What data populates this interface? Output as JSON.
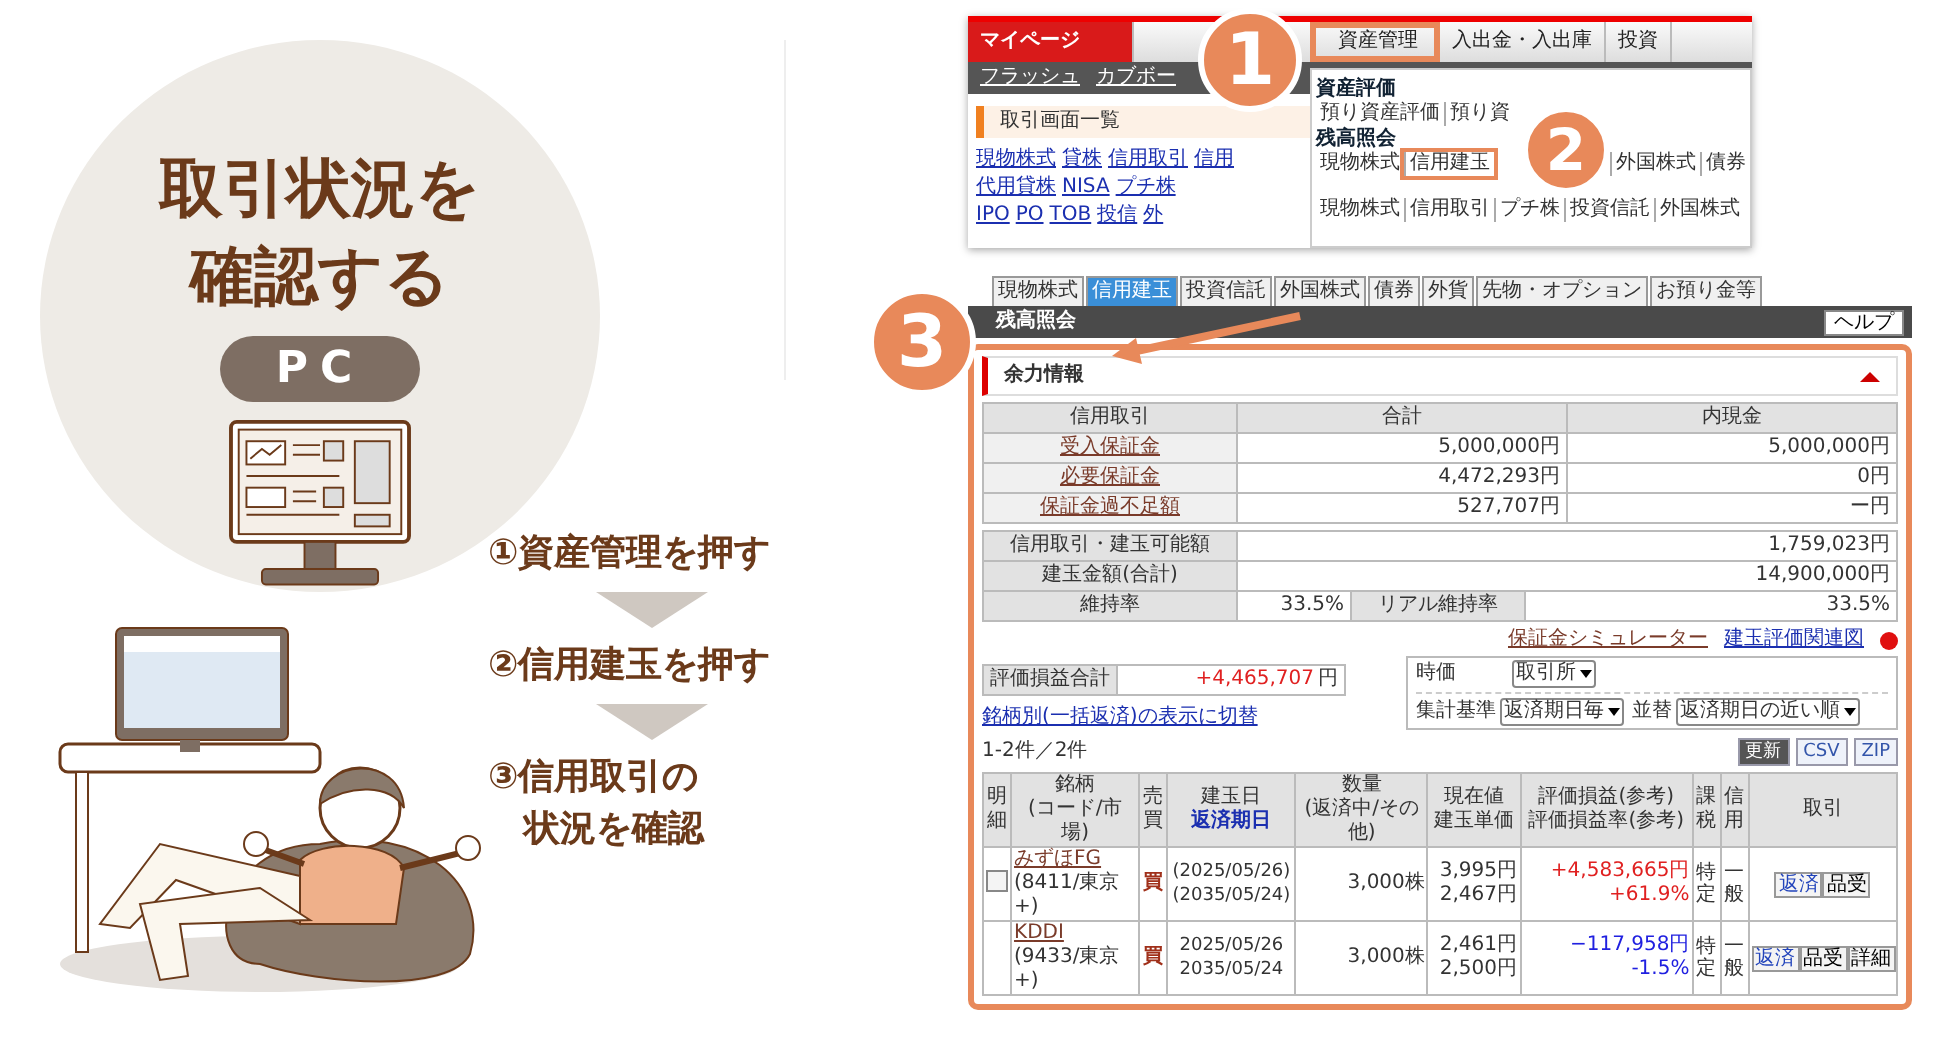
{
  "hero": {
    "title": [
      "取引状況を",
      "確認する"
    ],
    "badge": "PC"
  },
  "steps": [
    {
      "lines": [
        "①資産管理を押す"
      ]
    },
    {
      "lines": [
        "②信用建玉を押す"
      ]
    },
    {
      "lines": [
        "③信用取引の",
        "状況を確認"
      ]
    }
  ],
  "callouts": [
    "1",
    "2",
    "3"
  ],
  "menu_screen": {
    "nav": [
      {
        "label": "マイページ",
        "kind": "mypage",
        "selected": false
      },
      {
        "label": "資産管理",
        "kind": "tab",
        "selected": true
      },
      {
        "label": "入出金・入出庫",
        "kind": "tab",
        "selected": false
      },
      {
        "label": "投資",
        "kind": "tab",
        "selected": false
      }
    ],
    "tools": [
      "フラッシュ",
      "カブボー"
    ],
    "section": "取引画面一覧",
    "link_rows": [
      [
        "現物株式",
        "貸株",
        "信用取引",
        "信用"
      ],
      [
        "代用貸株",
        "NISA",
        "プチ株"
      ],
      [
        "IPO",
        "PO",
        "TOB",
        "投信",
        "外"
      ]
    ],
    "dropdown": [
      {
        "heading": "資産評価",
        "items": [
          {
            "label": "預り資産評価",
            "selected": false
          },
          {
            "label": "預り資",
            "selected": false
          }
        ]
      },
      {
        "heading": "残高照会",
        "items": [
          {
            "label": "現物株式",
            "selected": false
          },
          {
            "label": "信用建玉",
            "selected": true
          },
          {
            "label": "外国株式",
            "selected": false
          },
          {
            "label": "債券",
            "selected": false
          }
        ]
      },
      {
        "items": [
          {
            "label": "現物株式",
            "selected": false
          },
          {
            "label": "信用取引",
            "selected": false
          },
          {
            "label": "プチ株",
            "selected": false
          },
          {
            "label": "投資信託",
            "selected": false
          },
          {
            "label": "外国株式",
            "selected": false
          }
        ]
      }
    ]
  },
  "position_screen": {
    "tabs": [
      {
        "label": "現物株式",
        "selected": false
      },
      {
        "label": "信用建玉",
        "selected": true
      },
      {
        "label": "投資信託",
        "selected": false
      },
      {
        "label": "外国株式",
        "selected": false
      },
      {
        "label": "債券",
        "selected": false
      },
      {
        "label": "外貨",
        "selected": false
      },
      {
        "label": "先物・オプション",
        "selected": false
      },
      {
        "label": "お預り金等",
        "selected": false
      }
    ],
    "title_bar": "残高照会",
    "help": "ヘルプ",
    "panel_title": "余力情報",
    "margin_table": {
      "columns": [
        "信用取引",
        "合計",
        "内現金"
      ],
      "rows": [
        [
          "受入保証金",
          "5,000,000円",
          "5,000,000円"
        ],
        [
          "必要保証金",
          "4,472,293円",
          "0円"
        ],
        [
          "保証金過不足額",
          "527,707円",
          "ー円"
        ]
      ]
    },
    "capacity_rows": [
      {
        "label": "信用取引・建玉可能額",
        "value": "1,759,023円"
      },
      {
        "label": "建玉金額(合計)",
        "value": "14,900,000円"
      }
    ],
    "ratio": {
      "label": "維持率",
      "value": "33.5%",
      "real_label": "リアル維持率",
      "real_value": "33.5%"
    },
    "links": [
      "保証金シミュレーター",
      "建玉評価関連図"
    ],
    "pl_total": {
      "label": "評価損益合計",
      "value": "+4,465,707",
      "unit": "円",
      "gain": true
    },
    "filters": [
      {
        "label": "時価",
        "value": "取引所"
      },
      {
        "label": "集計基準",
        "value": "返済期日毎"
      },
      {
        "label": "並替",
        "value": "返済期日の近い順"
      }
    ],
    "switch_link": "銘柄別(一括返済)の表示に切替",
    "count": "1-2件／2件",
    "tools": [
      "更新",
      "CSV",
      "ZIP"
    ],
    "columns": [
      [
        "明",
        "細"
      ],
      [
        "銘柄",
        "(コード/市場)"
      ],
      [
        "売",
        "買"
      ],
      [
        "建玉日",
        "**返済期日**"
      ],
      [
        "数量",
        "(返済中/その他)"
      ],
      [
        "現在値",
        "建玉単価"
      ],
      [
        "評価損益(参考)",
        "評価損益率(参考)"
      ],
      [
        "課",
        "税"
      ],
      [
        "信",
        "用"
      ],
      [
        "取引"
      ]
    ],
    "rows": [
      {
        "detail": true,
        "name": "みずほFG",
        "code": "(8411/東京+)",
        "side": "買",
        "dates": [
          "(2025/05/26)",
          "(2035/05/24)"
        ],
        "qty": "3,000株",
        "prices": [
          "3,995円",
          "2,467円"
        ],
        "pl": "+4,583,665円",
        "pl_rate": "+61.9%",
        "gain": true,
        "tax": "特定",
        "credit": "一般",
        "actions": [
          "返済",
          "品受"
        ]
      },
      {
        "detail": false,
        "name": "KDDI",
        "code": "(9433/東京+)",
        "side": "買",
        "dates": [
          "2025/05/26",
          "2035/05/24"
        ],
        "qty": "3,000株",
        "prices": [
          "2,461円",
          "2,500円"
        ],
        "pl": "−117,958円",
        "pl_rate": "-1.5%",
        "gain": false,
        "actions": [
          "返済",
          "品受",
          "詳細"
        ],
        "tax": "特定",
        "credit": "一般"
      }
    ]
  }
}
